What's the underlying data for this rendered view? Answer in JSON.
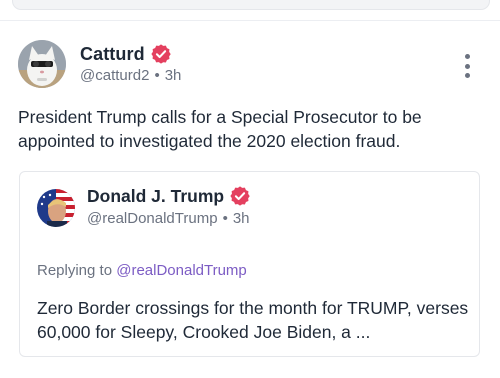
{
  "post": {
    "author_name": "Catturd",
    "author_handle": "@catturd2",
    "separator": "•",
    "time": "3h",
    "text": "President Trump calls for a Special Prosecutor to be appointed to investigated the 2020 election fraud."
  },
  "quoted_post": {
    "author_name": "Donald J. Trump",
    "author_handle": "@realDonaldTrump",
    "separator": "•",
    "time": "3h",
    "replying_prefix": "Replying to",
    "replying_mention": "@realDonaldTrump",
    "text": "Zero Border crossings for the month for TRUMP, verses 60,000 for Sleepy, Crooked Joe Biden, a ..."
  },
  "icons": {
    "verified": "verified-badge-icon",
    "more": "more-options-icon"
  },
  "colors": {
    "verified_badge": "#e4405f",
    "mention": "#7c5cc4",
    "secondary_text": "#6b7280"
  }
}
